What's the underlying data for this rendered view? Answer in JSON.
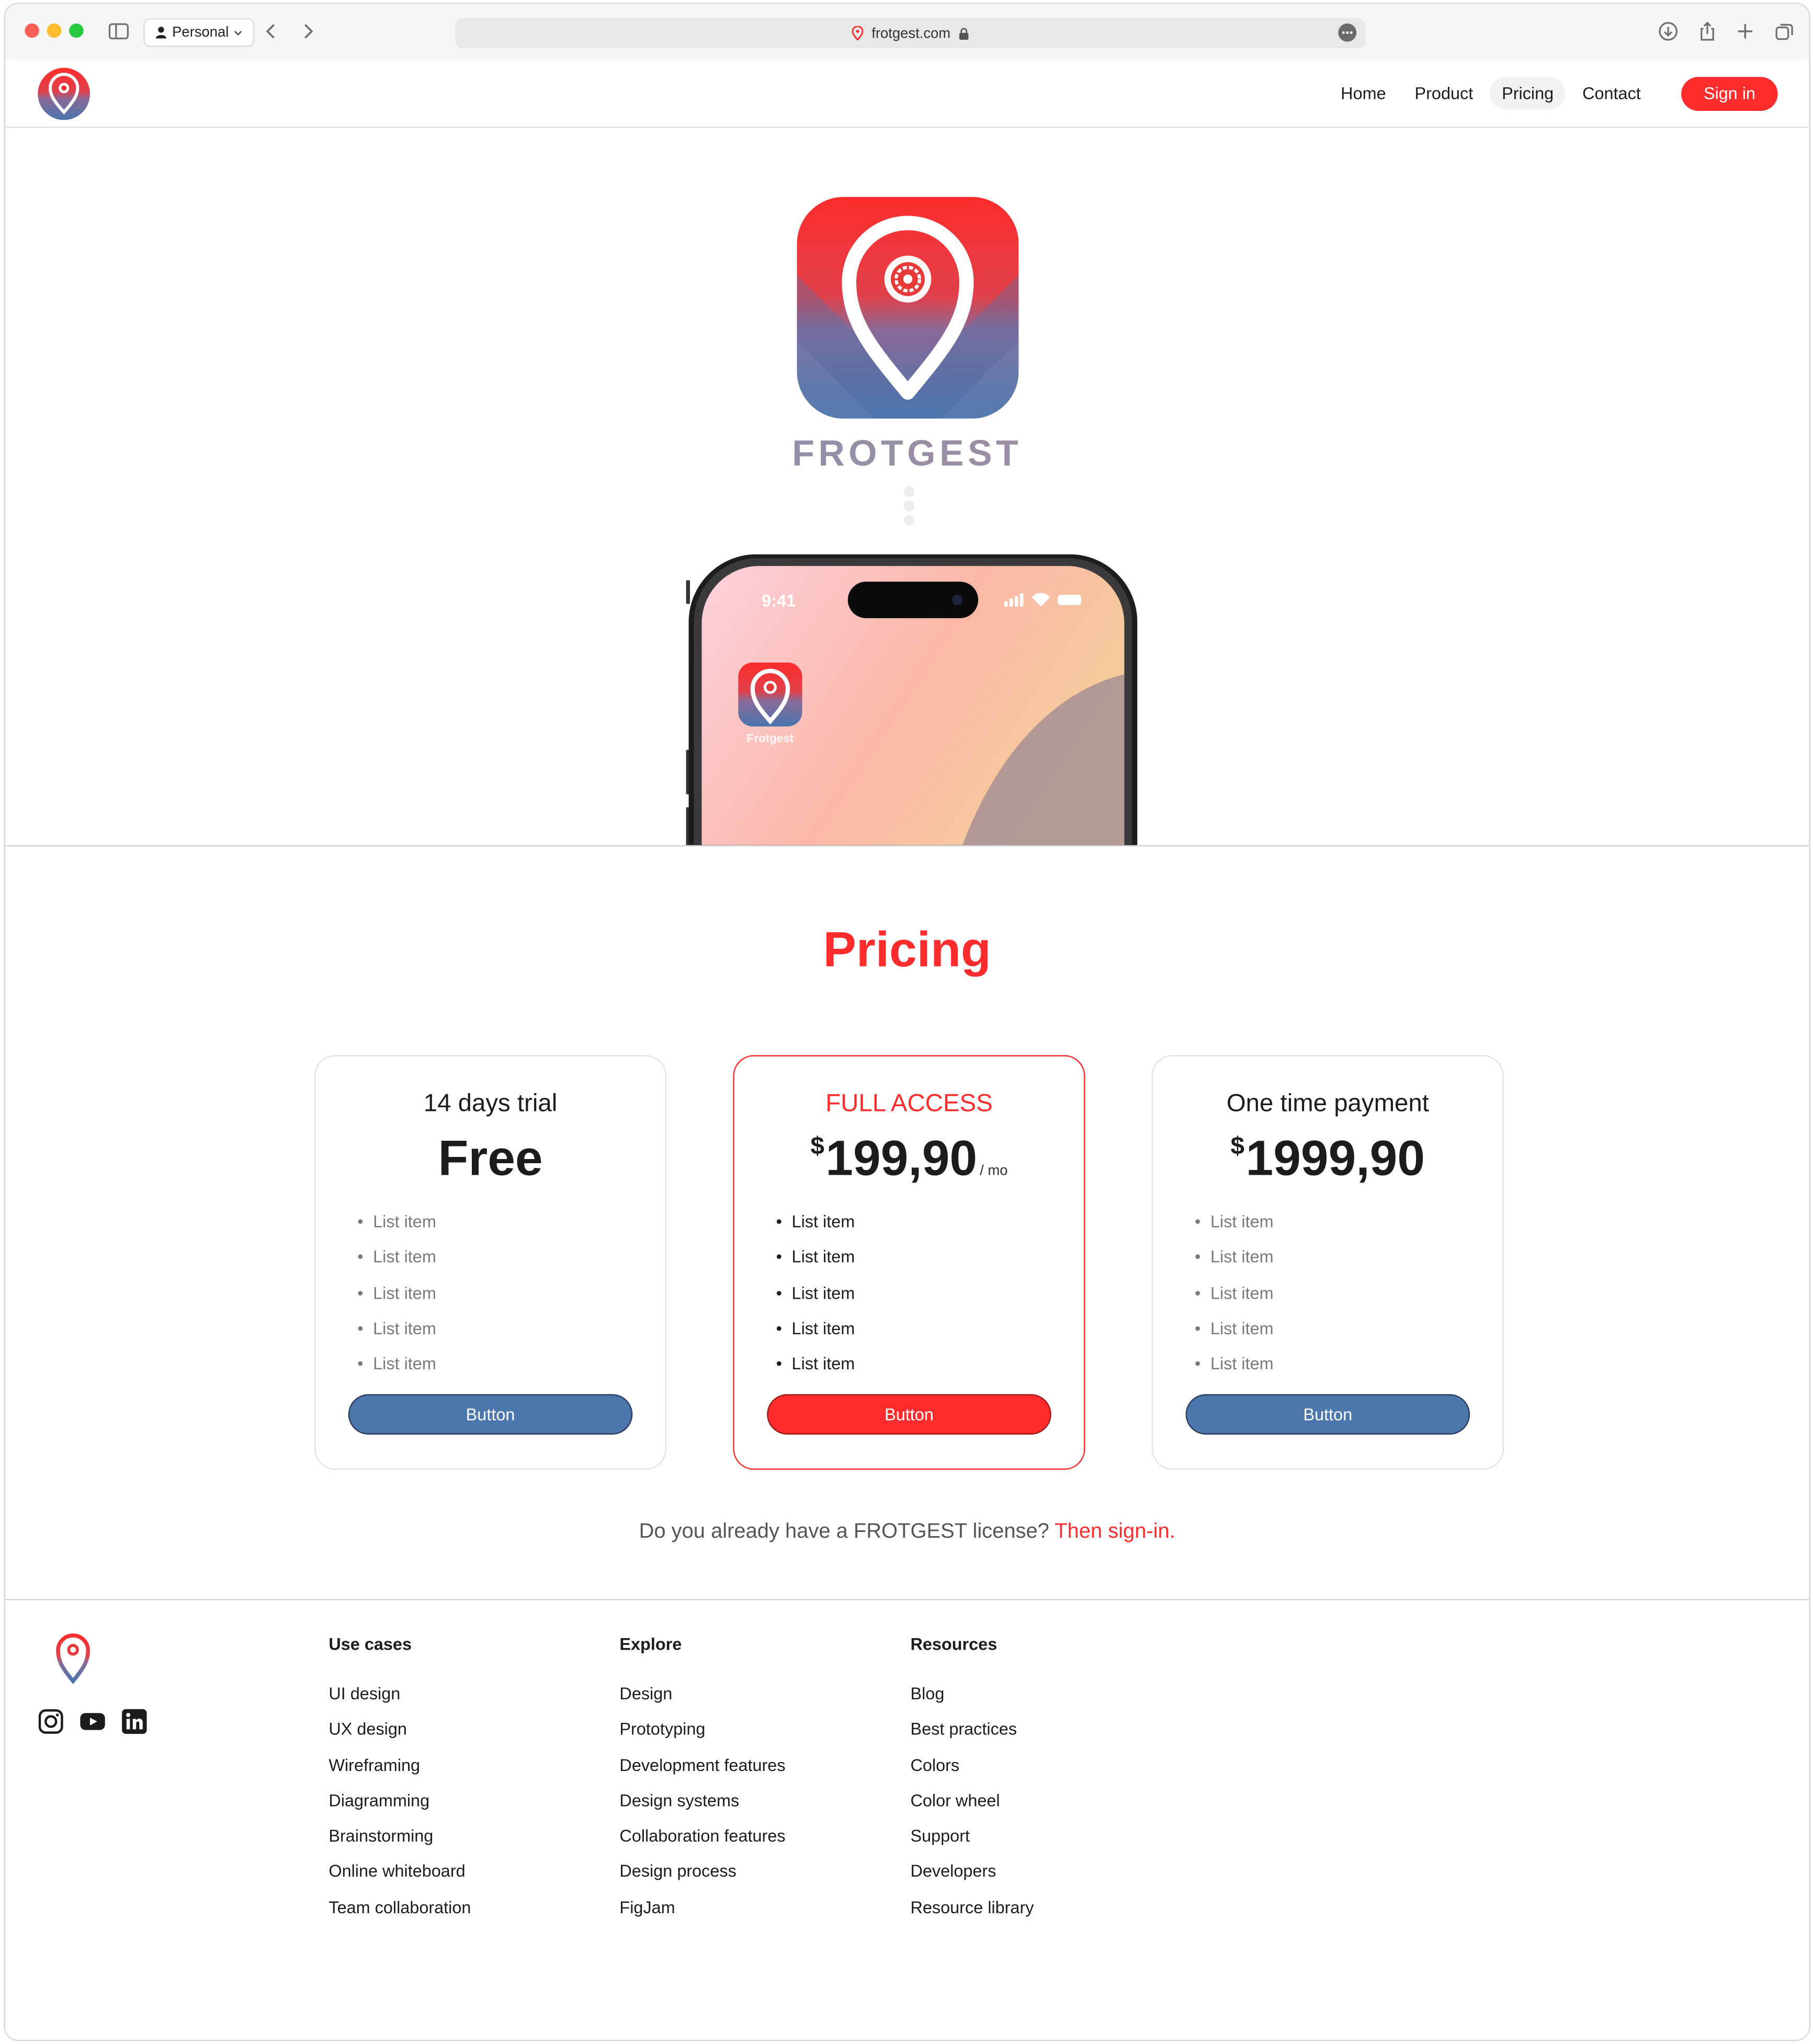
{
  "browser": {
    "profile": "Personal",
    "url": "frotgest.com"
  },
  "nav": {
    "links": [
      "Home",
      "Product",
      "Pricing",
      "Contact"
    ],
    "active": "Pricing",
    "signin": "Sign in"
  },
  "hero": {
    "brand": "FROTGEST",
    "phone_time": "9:41",
    "app_label": "Frotgest"
  },
  "pricing": {
    "title": "Pricing",
    "plans": [
      {
        "name": "14 days trial",
        "currency": "",
        "price": "Free",
        "period": "",
        "features": [
          "List item",
          "List item",
          "List item",
          "List item",
          "List item"
        ],
        "button": "Button"
      },
      {
        "name": "FULL ACCESS",
        "currency": "$",
        "price": "199,90",
        "period": "/ mo",
        "features": [
          "List item",
          "List item",
          "List item",
          "List item",
          "List item"
        ],
        "button": "Button"
      },
      {
        "name": "One time payment",
        "currency": "$",
        "price": "1999,90",
        "period": "",
        "features": [
          "List item",
          "List item",
          "List item",
          "List item",
          "List item"
        ],
        "button": "Button"
      }
    ],
    "license_text": "Do you already have a FROTGEST license?",
    "license_link": "Then sign-in."
  },
  "footer": {
    "columns": [
      {
        "title": "Use cases",
        "links": [
          "UI design",
          "UX design",
          "Wireframing",
          "Diagramming",
          "Brainstorming",
          "Online whiteboard",
          "Team collaboration"
        ]
      },
      {
        "title": "Explore",
        "links": [
          "Design",
          "Prototyping",
          "Development features",
          "Design systems",
          "Collaboration features",
          "Design process",
          "FigJam"
        ]
      },
      {
        "title": "Resources",
        "links": [
          "Blog",
          "Best practices",
          "Colors",
          "Color wheel",
          "Support",
          "Developers",
          "Resource library"
        ]
      }
    ],
    "social": [
      "instagram-icon",
      "youtube-icon",
      "linkedin-icon"
    ]
  },
  "colors": {
    "accent": "#fe2c2c",
    "primary_button": "#4b77ad"
  }
}
